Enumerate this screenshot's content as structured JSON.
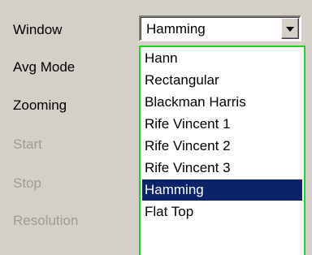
{
  "settings": {
    "labels": [
      {
        "text": "Window",
        "enabled": true
      },
      {
        "text": "Avg Mode",
        "enabled": true
      },
      {
        "text": "Zooming",
        "enabled": true
      },
      {
        "text": "Start",
        "enabled": false
      },
      {
        "text": "Stop",
        "enabled": false
      },
      {
        "text": "Resolution",
        "enabled": false
      }
    ]
  },
  "window_select": {
    "value": "Hamming",
    "options": [
      "Hann",
      "Rectangular",
      "Blackman Harris",
      "Rife Vincent 1",
      "Rife Vincent 2",
      "Rife Vincent 3",
      "Hamming",
      "Flat Top"
    ],
    "selected_index": 6
  },
  "colors": {
    "dialog_bg": "#d4d0c8",
    "disabled_text": "#a09c94",
    "highlight": "#0a246a",
    "dropdown_border": "#19d719"
  }
}
